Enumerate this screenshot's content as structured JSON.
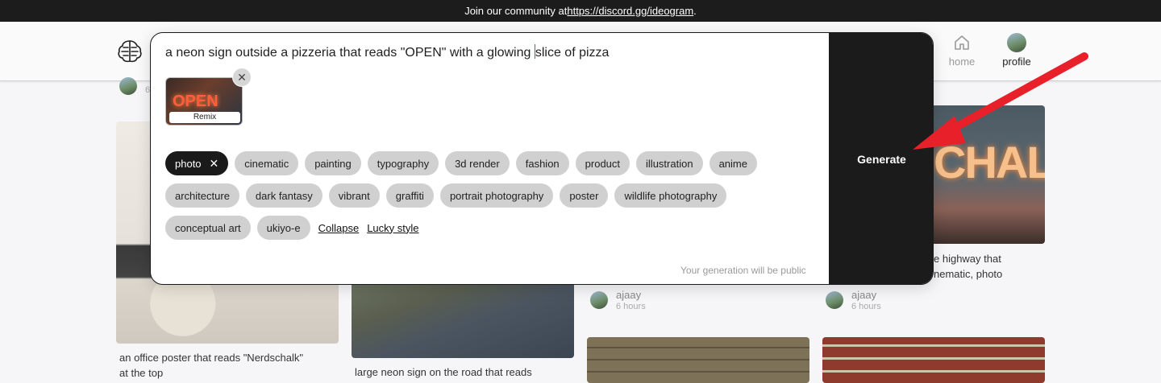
{
  "banner": {
    "prefix": "Join our community at ",
    "link": "https://discord.gg/ideogram",
    "suffix": "."
  },
  "nav": {
    "home_label": "home",
    "profile_label": "profile"
  },
  "prompt": {
    "text_before_caret": "a neon sign outside a pizzeria that reads \"OPEN\" with a glowing ",
    "text_after_caret": "slice of pizza",
    "remix_label": "Remix",
    "thumbnail_text": "OPEN",
    "public_note": "Your generation will be public",
    "generate_label": "Generate"
  },
  "styles": {
    "row1": [
      "photo",
      "cinematic",
      "painting",
      "typography",
      "3d render",
      "fashion",
      "product",
      "illustration",
      "anime"
    ],
    "row2": [
      "architecture",
      "dark fantasy",
      "vibrant",
      "graffiti",
      "portrait photography",
      "poster",
      "wildlife photography"
    ],
    "row3": [
      "conceptual art",
      "ukiyo-e"
    ],
    "selected": "photo",
    "collapse_label": "Collapse",
    "lucky_label": "Lucky style"
  },
  "feed": {
    "top_time_fragment": "6",
    "card1_caption_line1": "an office poster that reads \"Nerdschalk\"",
    "card1_caption_line2": "at the top",
    "card2_caption": "large neon sign on the road that reads",
    "card4_sign_text": "CHALK",
    "card4_caption_line1": "e highway that",
    "card4_caption_line2": "nematic, photo",
    "user_a_name": "ajaay",
    "user_a_time": "6 hours",
    "user_b_name": "ajaay",
    "user_b_time": "6 hours"
  },
  "colors": {
    "banner_bg": "#1c1c1c",
    "generate_bg": "#1b1b1b",
    "chip_bg": "#d0d0d0",
    "chip_selected_bg": "#1a1a1a",
    "annotation_arrow": "#e8202a"
  },
  "icons": {
    "logo": "brain-logo-icon",
    "home": "home-icon",
    "remove_thumbnail": "close-icon",
    "remove_style": "close-icon"
  }
}
